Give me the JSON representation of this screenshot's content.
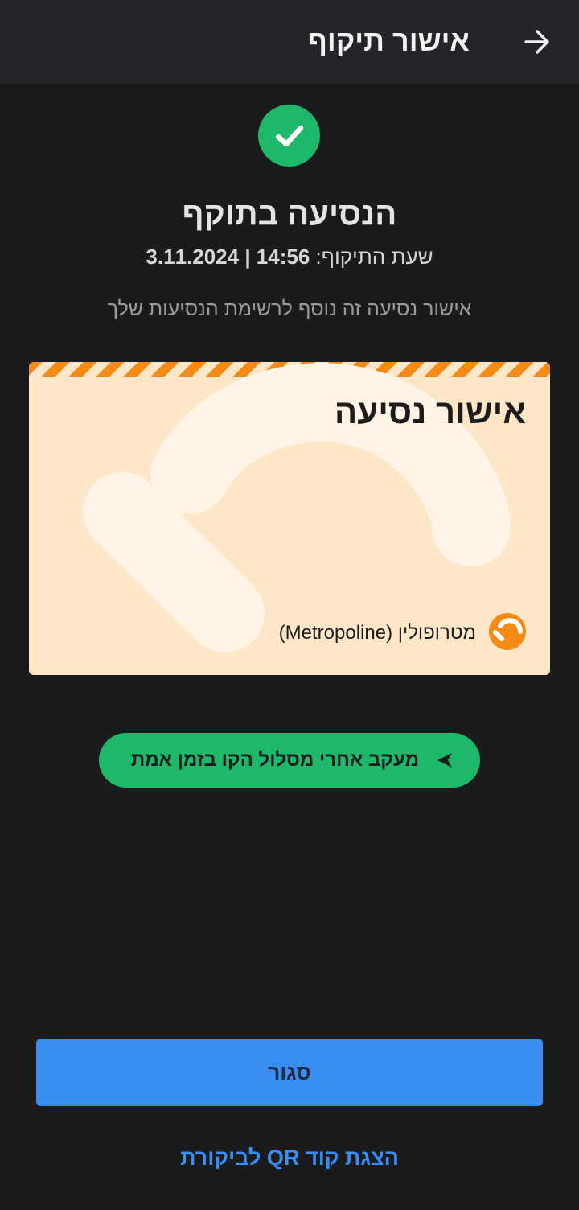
{
  "header": {
    "title": "אישור תיקוף",
    "back_icon": "arrow-right-icon"
  },
  "status": {
    "icon": "check-circle-icon",
    "title": "הנסיעה בתוקף",
    "validation_label": "שעת התיקוף:",
    "validation_value": "3.11.2024 | 14:56",
    "note": "אישור נסיעה זה נוסף לרשימת הנסיעות שלך"
  },
  "ticket": {
    "title": "אישור נסיעה",
    "operator_name": "מטרופולין (Metropoline)",
    "operator_icon": "metropoline-logo-icon"
  },
  "track_button": {
    "label": "מעקב אחרי מסלול הקו בזמן אמת",
    "icon": "navigation-arrow-icon"
  },
  "close_button": {
    "label": "סגור"
  },
  "qr_link": {
    "label": "הצגת קוד QR לביקורת"
  },
  "colors": {
    "background": "#1a1b1d",
    "header": "#242528",
    "success": "#1db86a",
    "primary": "#3a8ef2",
    "ticket_bg": "#fee6c9",
    "ticket_accent": "#f58b14"
  }
}
